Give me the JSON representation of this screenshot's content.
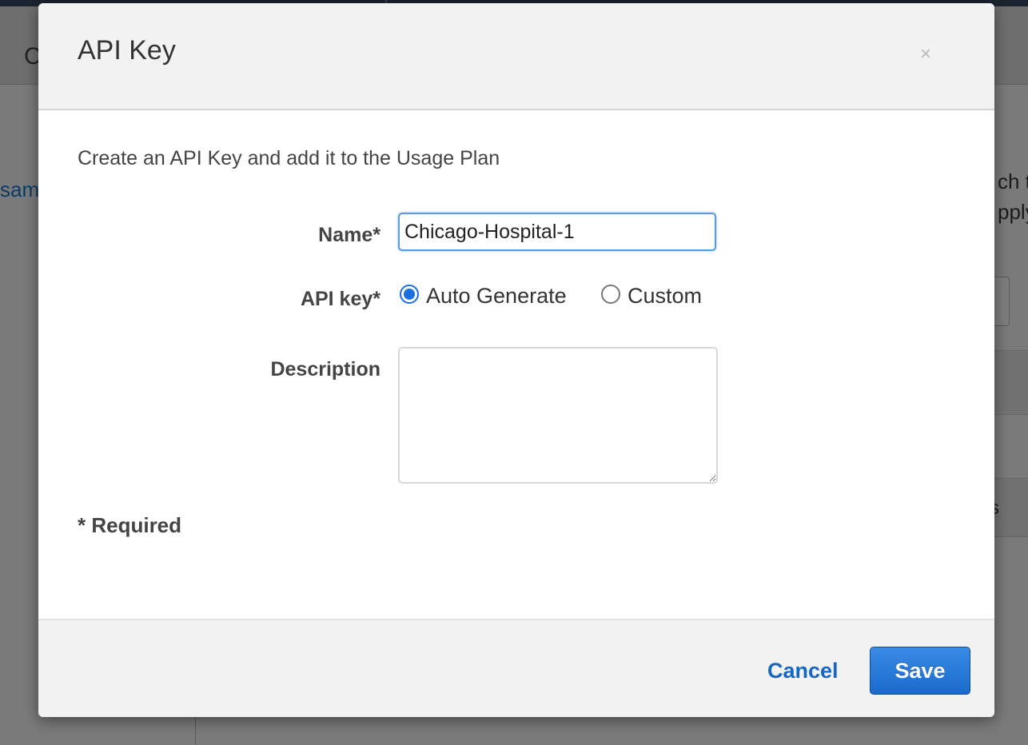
{
  "background": {
    "header_text": "C",
    "left_link": "sam",
    "right_text_1": "ch t",
    "right_text_2": "pply",
    "right_text_3": "s"
  },
  "modal": {
    "title": "API Key",
    "close_glyph": "×",
    "intro": "Create an API Key and add it to the Usage Plan",
    "name_label": "Name*",
    "name_value": "Chicago-Hospital-1",
    "api_key_label": "API key*",
    "api_key_options": [
      {
        "label": "Auto Generate",
        "selected": true
      },
      {
        "label": "Custom",
        "selected": false
      }
    ],
    "description_label": "Description",
    "description_value": "",
    "required_note": "* Required",
    "cancel_label": "Cancel",
    "save_label": "Save"
  },
  "colors": {
    "accent": "#1d6fe0",
    "link": "#1467c2",
    "save_button": "#1a6acc"
  }
}
